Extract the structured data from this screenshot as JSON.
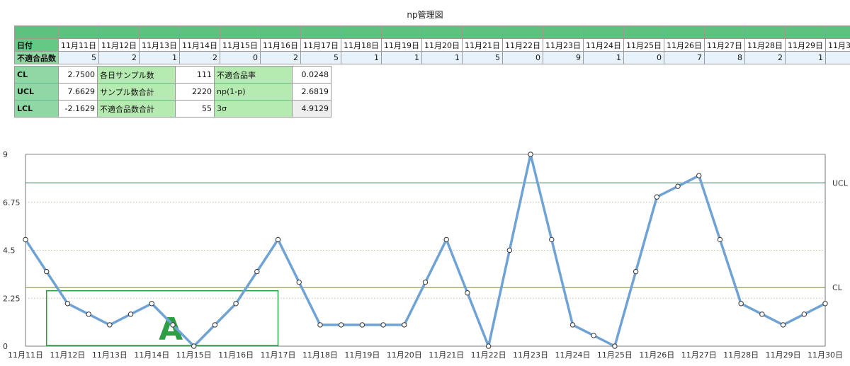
{
  "title": "np管理図",
  "table": {
    "date_label": "日付",
    "count_label": "不適合品数",
    "dates": [
      "11月11日",
      "11月12日",
      "11月13日",
      "11月14日",
      "11月15日",
      "11月16日",
      "11月17日",
      "11月18日",
      "11月19日",
      "11月20日",
      "11月21日",
      "11月22日",
      "11月23日",
      "11月24日",
      "11月25日",
      "11月26日",
      "11月27日",
      "11月28日",
      "11月29日",
      "11月30日"
    ],
    "counts": [
      5,
      2,
      1,
      2,
      0,
      2,
      5,
      1,
      1,
      1,
      5,
      0,
      9,
      1,
      0,
      7,
      8,
      2,
      1,
      2
    ]
  },
  "stats": {
    "rows": [
      {
        "label": "CL",
        "value": "2.7500",
        "name": "各日サンプル数",
        "name_value": "111",
        "param": "不適合品率",
        "param_value": "0.0248"
      },
      {
        "label": "UCL",
        "value": "7.6629",
        "name": "サンプル数合計",
        "name_value": "2220",
        "param": "np(1-p)",
        "param_value": "2.6819"
      },
      {
        "label": "LCL",
        "value": "-2.1629",
        "name": "不適合品数合計",
        "name_value": "55",
        "param": "3σ",
        "param_value": "4.9129"
      }
    ]
  },
  "chart_data": {
    "type": "line",
    "title": "",
    "x_labels": [
      "11月11日",
      "11月12日",
      "11月13日",
      "11月14日",
      "11月15日",
      "11月16日",
      "11月17日",
      "11月18日",
      "11月19日",
      "11月20日",
      "11月21日",
      "11月22日",
      "11月23日",
      "11月24日",
      "11月25日",
      "11月26日",
      "11月27日",
      "11月28日",
      "11月29日",
      "11月30日"
    ],
    "values": [
      5,
      3.5,
      2,
      1.5,
      1,
      1.5,
      2,
      1,
      0,
      1,
      2,
      3.5,
      5,
      3,
      1,
      1,
      1,
      1,
      1,
      3,
      5,
      2.5,
      0,
      4.5,
      9,
      5,
      1,
      0.5,
      0,
      3.5,
      7,
      7.5,
      8,
      5,
      2,
      1.5,
      1,
      1.5,
      2
    ],
    "ylim": [
      0,
      9
    ],
    "yticks": [
      "0",
      "2.25",
      "4.5",
      "6.75",
      "9"
    ],
    "ucl": 7.6629,
    "cl": 2.75,
    "ucl_label": "UCL",
    "cl_label": "CL",
    "grid": "horizontal dotted",
    "line_color": "#6fa2d5",
    "ucl_color": "#3d7b5a",
    "cl_color": "#7c8c40",
    "annotation": {
      "text": "A",
      "x_from": 0.5,
      "x_to": 6,
      "y_from": 0,
      "y_to": 2.6,
      "color": "#2c9e44"
    }
  }
}
